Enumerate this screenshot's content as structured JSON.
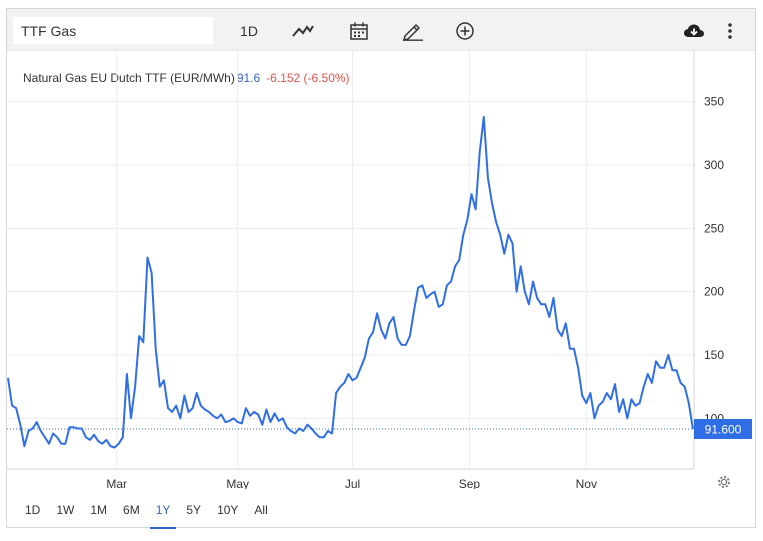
{
  "toolbar": {
    "search_value": "TTF Gas",
    "interval_label": "1D",
    "icons": [
      "line-chart-icon",
      "calendar-icon",
      "pencil-icon",
      "plus-circle-icon",
      "cloud-download-icon",
      "more-vertical-icon"
    ]
  },
  "legend": {
    "name": "Natural Gas EU Dutch TTF (EUR/MWh)",
    "value": "91.6",
    "change": "-6.152 (-6.50%)"
  },
  "price_label": "91.600",
  "ranges": [
    {
      "label": "1D",
      "active": false
    },
    {
      "label": "1W",
      "active": false
    },
    {
      "label": "1M",
      "active": false
    },
    {
      "label": "6M",
      "active": false
    },
    {
      "label": "1Y",
      "active": true
    },
    {
      "label": "5Y",
      "active": false
    },
    {
      "label": "10Y",
      "active": false
    },
    {
      "label": "All",
      "active": false
    }
  ],
  "colors": {
    "line": "#2f6ee5",
    "price_label_bg": "#2f6ee5",
    "change": "#d9534f",
    "grid": "#ececec"
  },
  "chart_data": {
    "type": "line",
    "title": "",
    "xlabel": "",
    "ylabel": "",
    "x_tick_labels": [
      "Mar",
      "May",
      "Jul",
      "Sep",
      "Nov"
    ],
    "x_tick_positions": [
      53,
      112,
      168,
      225,
      282
    ],
    "y_ticks": [
      100,
      150,
      200,
      250,
      300,
      350
    ],
    "y_tick_labels": [
      "100",
      "150",
      "200",
      "250",
      "300",
      "350"
    ],
    "ylim": [
      60,
      390
    ],
    "xlim": [
      0,
      335
    ],
    "last_value": 91.6,
    "grid": true,
    "series": [
      {
        "name": "",
        "points": [
          [
            0,
            132
          ],
          [
            2,
            110
          ],
          [
            4,
            108
          ],
          [
            6,
            95
          ],
          [
            8,
            78
          ],
          [
            10,
            90
          ],
          [
            12,
            92
          ],
          [
            14,
            97
          ],
          [
            16,
            90
          ],
          [
            18,
            85
          ],
          [
            20,
            80
          ],
          [
            22,
            88
          ],
          [
            24,
            85
          ],
          [
            26,
            80
          ],
          [
            28,
            80
          ],
          [
            30,
            93
          ],
          [
            32,
            93
          ],
          [
            34,
            92
          ],
          [
            36,
            92
          ],
          [
            38,
            85
          ],
          [
            40,
            83
          ],
          [
            42,
            87
          ],
          [
            44,
            82
          ],
          [
            46,
            80
          ],
          [
            48,
            83
          ],
          [
            50,
            78
          ],
          [
            52,
            77
          ],
          [
            54,
            80
          ],
          [
            56,
            85
          ],
          [
            58,
            135
          ],
          [
            60,
            100
          ],
          [
            62,
            125
          ],
          [
            64,
            165
          ],
          [
            66,
            160
          ],
          [
            68,
            227
          ],
          [
            70,
            215
          ],
          [
            72,
            155
          ],
          [
            74,
            125
          ],
          [
            76,
            130
          ],
          [
            78,
            108
          ],
          [
            80,
            105
          ],
          [
            82,
            110
          ],
          [
            84,
            100
          ],
          [
            86,
            118
          ],
          [
            88,
            105
          ],
          [
            90,
            108
          ],
          [
            92,
            120
          ],
          [
            94,
            110
          ],
          [
            96,
            107
          ],
          [
            98,
            105
          ],
          [
            100,
            102
          ],
          [
            102,
            100
          ],
          [
            104,
            103
          ],
          [
            106,
            97
          ],
          [
            108,
            98
          ],
          [
            110,
            100
          ],
          [
            112,
            97
          ],
          [
            114,
            96
          ],
          [
            116,
            108
          ],
          [
            118,
            102
          ],
          [
            120,
            105
          ],
          [
            122,
            103
          ],
          [
            124,
            95
          ],
          [
            126,
            107
          ],
          [
            128,
            97
          ],
          [
            130,
            104
          ],
          [
            132,
            98
          ],
          [
            134,
            100
          ],
          [
            136,
            93
          ],
          [
            138,
            90
          ],
          [
            140,
            88
          ],
          [
            142,
            92
          ],
          [
            144,
            90
          ],
          [
            146,
            95
          ],
          [
            148,
            92
          ],
          [
            150,
            88
          ],
          [
            152,
            85
          ],
          [
            154,
            85
          ],
          [
            156,
            90
          ],
          [
            158,
            88
          ],
          [
            160,
            120
          ],
          [
            162,
            125
          ],
          [
            164,
            128
          ],
          [
            166,
            135
          ],
          [
            168,
            130
          ],
          [
            170,
            132
          ],
          [
            172,
            140
          ],
          [
            174,
            148
          ],
          [
            176,
            163
          ],
          [
            178,
            168
          ],
          [
            180,
            183
          ],
          [
            182,
            170
          ],
          [
            184,
            163
          ],
          [
            186,
            175
          ],
          [
            188,
            180
          ],
          [
            190,
            163
          ],
          [
            192,
            158
          ],
          [
            194,
            158
          ],
          [
            196,
            165
          ],
          [
            198,
            185
          ],
          [
            200,
            203
          ],
          [
            202,
            205
          ],
          [
            204,
            195
          ],
          [
            206,
            198
          ],
          [
            208,
            200
          ],
          [
            210,
            188
          ],
          [
            212,
            190
          ],
          [
            214,
            205
          ],
          [
            216,
            208
          ],
          [
            218,
            220
          ],
          [
            220,
            225
          ],
          [
            222,
            245
          ],
          [
            224,
            257
          ],
          [
            226,
            277
          ],
          [
            228,
            265
          ],
          [
            230,
            310
          ],
          [
            232,
            338
          ],
          [
            234,
            290
          ],
          [
            236,
            270
          ],
          [
            238,
            255
          ],
          [
            240,
            245
          ],
          [
            242,
            230
          ],
          [
            244,
            245
          ],
          [
            246,
            238
          ],
          [
            248,
            200
          ],
          [
            250,
            220
          ],
          [
            252,
            200
          ],
          [
            254,
            190
          ],
          [
            256,
            208
          ],
          [
            258,
            195
          ],
          [
            260,
            190
          ],
          [
            262,
            190
          ],
          [
            264,
            180
          ],
          [
            266,
            195
          ],
          [
            268,
            170
          ],
          [
            270,
            165
          ],
          [
            272,
            175
          ],
          [
            274,
            155
          ],
          [
            276,
            155
          ],
          [
            278,
            140
          ],
          [
            280,
            118
          ],
          [
            282,
            112
          ],
          [
            284,
            120
          ],
          [
            286,
            100
          ],
          [
            288,
            110
          ],
          [
            290,
            113
          ],
          [
            292,
            120
          ],
          [
            294,
            115
          ],
          [
            296,
            127
          ],
          [
            298,
            105
          ],
          [
            300,
            115
          ],
          [
            302,
            100
          ],
          [
            304,
            115
          ],
          [
            306,
            110
          ],
          [
            308,
            112
          ],
          [
            310,
            125
          ],
          [
            312,
            135
          ],
          [
            314,
            128
          ],
          [
            316,
            145
          ],
          [
            318,
            140
          ],
          [
            320,
            140
          ],
          [
            322,
            150
          ],
          [
            324,
            138
          ],
          [
            326,
            138
          ],
          [
            328,
            128
          ],
          [
            330,
            125
          ],
          [
            332,
            112
          ],
          [
            334,
            91.6
          ]
        ]
      }
    ]
  }
}
